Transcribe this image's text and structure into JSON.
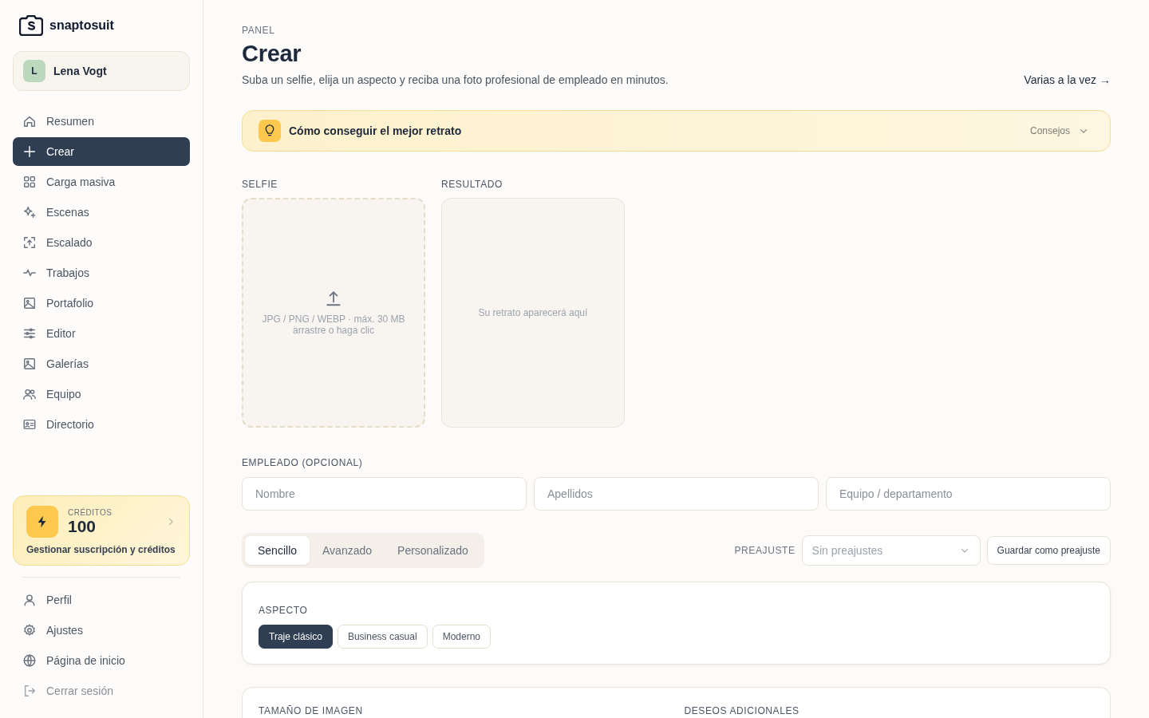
{
  "brand": {
    "name": "snaptosuit"
  },
  "user": {
    "initial": "L",
    "name": "Lena Vogt"
  },
  "nav": [
    {
      "label": "Resumen",
      "selected": false
    },
    {
      "label": "Crear",
      "selected": true
    },
    {
      "label": "Carga masiva",
      "selected": false
    },
    {
      "label": "Escenas",
      "selected": false
    },
    {
      "label": "Escalado",
      "selected": false
    },
    {
      "label": "Trabajos",
      "selected": false
    },
    {
      "label": "Portafolio",
      "selected": false
    },
    {
      "label": "Editor",
      "selected": false
    },
    {
      "label": "Galerías",
      "selected": false
    },
    {
      "label": "Equipo",
      "selected": false
    },
    {
      "label": "Directorio",
      "selected": false
    }
  ],
  "credits": {
    "label": "CRÉDITOS",
    "value": "100",
    "link": "Gestionar suscripción y créditos"
  },
  "bottom_nav": [
    {
      "label": "Perfil",
      "kind": "link"
    },
    {
      "label": "Ajustes",
      "kind": "link"
    },
    {
      "label": "Página de inicio",
      "kind": "link"
    },
    {
      "label": "Cerrar sesión",
      "kind": "logout"
    }
  ],
  "header": {
    "eyebrow": "PANEL",
    "title": "Crear",
    "subtitle": "Suba un selfie, elija un aspecto y reciba una foto profesional de empleado en minutos.",
    "link": "Varias a la vez →"
  },
  "tips": {
    "title": "Cómo conseguir el mejor retrato",
    "toggle": "Consejos",
    "expanded": false
  },
  "selfie": {
    "label": "SELFIE",
    "hint": "JPG / PNG / WEBP · máx. 30 MB",
    "action": "arrastre o haga clic"
  },
  "result": {
    "label": "RESULTADO",
    "placeholder": "Su retrato aparecerá aquí"
  },
  "employee": {
    "label": "EMPLEADO (OPCIONAL)",
    "fields": [
      {
        "placeholder": "Nombre"
      },
      {
        "placeholder": "Apellidos"
      },
      {
        "placeholder": "Equipo / departamento"
      }
    ]
  },
  "modes": [
    {
      "label": "Sencillo",
      "selected": true
    },
    {
      "label": "Avanzado",
      "selected": false
    },
    {
      "label": "Personalizado",
      "selected": false
    }
  ],
  "preset": {
    "label": "PREAJUSTE",
    "placeholder": "Sin preajustes",
    "save": "Guardar como preajuste"
  },
  "aspect": {
    "label": "ASPECTO",
    "options": [
      {
        "label": "Traje clásico",
        "selected": true
      },
      {
        "label": "Business casual",
        "selected": false
      },
      {
        "label": "Moderno",
        "selected": false
      }
    ]
  },
  "next_card": {
    "labels": [
      "TAMAÑO DE IMAGEN",
      "DESEOS ADICIONALES"
    ]
  }
}
